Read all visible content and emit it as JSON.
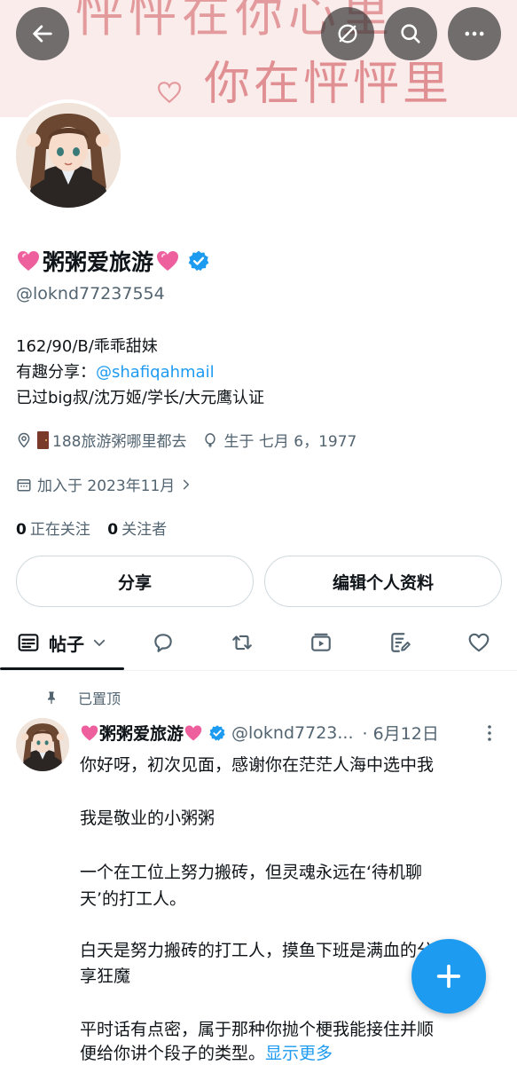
{
  "banner": {
    "line1": "怦怦在你心里",
    "line2": "你在怦怦里"
  },
  "profile": {
    "name": "粥粥爱旅游",
    "handle": "@loknd77237554",
    "bio_line1": "162/90/B/乖乖甜妹",
    "bio_line2_prefix": "有趣分享：",
    "bio_line2_link": "@shafiqahmail",
    "bio_line3": "已过big叔/沈万姬/学长/大元鹰认证",
    "location": "188旅游粥哪里都去",
    "birthday": "生于 七月 6，1977",
    "joined": "加入于 2023年11月",
    "following_count": "0",
    "following_label": "正在关注",
    "followers_count": "0",
    "followers_label": "关注者"
  },
  "buttons": {
    "share": "分享",
    "edit_profile": "编辑个人资料"
  },
  "tabs": {
    "posts_label": "帖子"
  },
  "post": {
    "pinned_label": "已置顶",
    "author_name": "粥粥爱旅游",
    "author_handle": "@loknd7723...",
    "date": "· 6月12日",
    "lines": [
      "你好呀，初次见面，感谢你在茫茫人海中选中我",
      "我是敬业的小粥粥",
      "一个在工位上努力搬砖，但灵魂永远在‘待机聊",
      "天’的打工人。",
      "白天是努力搬砖的打工人，摸鱼下班是满血的分",
      "享狂魔",
      "平时话有点密，属于那种你抛个梗我能接住并顺",
      "便给你讲个段子的类型。"
    ],
    "show_more": "显示更多"
  },
  "colors": {
    "accent": "#1d9bf0",
    "secondary_text": "#536471",
    "primary_text": "#0f1419"
  }
}
